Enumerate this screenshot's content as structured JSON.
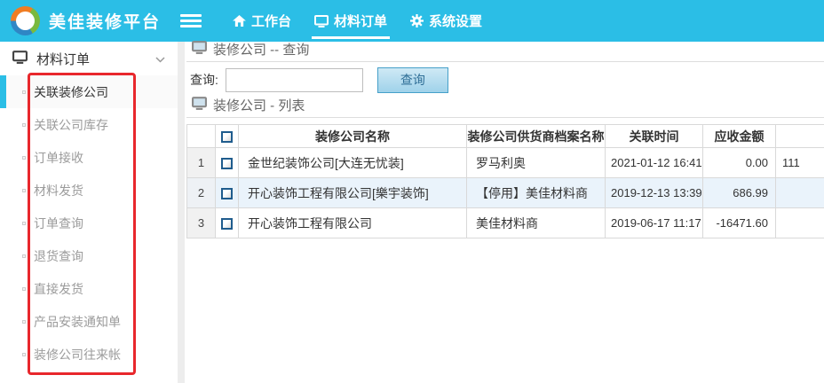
{
  "colors": {
    "topbar_bg": "#2bbee6",
    "active_indicator": "#2bbee6",
    "annotation_red": "#e8272c",
    "alt_row_bg": "#eaf3fb",
    "button_border": "#46a0c9"
  },
  "topbar": {
    "brand": "美佳装修平台",
    "nav": [
      {
        "label": "工作台",
        "icon": "home-icon"
      },
      {
        "label": "材料订单",
        "icon": "monitor-icon"
      },
      {
        "label": "系统设置",
        "icon": "gear-icon"
      }
    ]
  },
  "sidebar": {
    "title": "材料订单",
    "items": [
      {
        "label": "关联装修公司"
      },
      {
        "label": "关联公司库存"
      },
      {
        "label": "订单接收"
      },
      {
        "label": "材料发货"
      },
      {
        "label": "订单查询"
      },
      {
        "label": "退货查询"
      },
      {
        "label": "直接发货"
      },
      {
        "label": "产品安装通知单"
      },
      {
        "label": "装修公司往来帐"
      }
    ]
  },
  "main": {
    "query_section": {
      "title": "装修公司 -- 查询",
      "label": "查询:",
      "value": "",
      "button": "查询"
    },
    "list_section": {
      "title": "装修公司 - 列表"
    },
    "table": {
      "columns": [
        "装修公司名称",
        "装修公司供货商档案名称",
        "关联时间",
        "应收金额",
        ""
      ],
      "rows": [
        {
          "index": "1",
          "name": "金世纪装饰公司[大连无忧装]",
          "supplier": "罗马利奥",
          "linked_time": "2021-01-12 16:41",
          "receivable": "0.00",
          "extra": "111"
        },
        {
          "index": "2",
          "name": "开心装饰工程有限公司[樂宇装饰]",
          "supplier": "【停用】美佳材料商",
          "linked_time": "2019-12-13 13:39",
          "receivable": "686.99",
          "extra": ""
        },
        {
          "index": "3",
          "name": "开心装饰工程有限公司",
          "supplier": "美佳材料商",
          "linked_time": "2019-06-17 11:17",
          "receivable": "-16471.60",
          "extra": ""
        }
      ]
    }
  }
}
